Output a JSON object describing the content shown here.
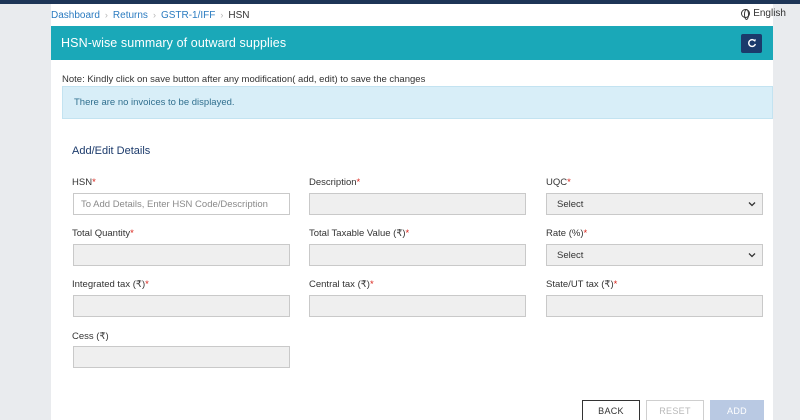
{
  "breadcrumb": {
    "items": [
      "Dashboard",
      "Returns",
      "GSTR-1/IFF"
    ],
    "current": "HSN"
  },
  "language": "English",
  "panel": {
    "title": "HSN-wise summary of outward supplies"
  },
  "note": "Note: Kindly click on save button after any modification( add, edit) to save the changes",
  "alert": "There are no invoices to be displayed.",
  "form": {
    "section_title": "Add/Edit Details",
    "fields": {
      "hsn": {
        "label": "HSN",
        "placeholder": "To Add Details, Enter HSN Code/Description",
        "required": true
      },
      "description": {
        "label": "Description",
        "required": true
      },
      "uqc": {
        "label": "UQC",
        "selected": "Select",
        "required": true
      },
      "total_quantity": {
        "label": "Total Quantity",
        "required": true
      },
      "total_taxable_value": {
        "label": "Total Taxable Value (₹)",
        "required": true
      },
      "rate": {
        "label": "Rate (%)",
        "selected": "Select",
        "required": true
      },
      "integrated_tax": {
        "label": "Integrated tax (₹)",
        "required": true
      },
      "central_tax": {
        "label": "Central tax (₹)",
        "required": true
      },
      "state_ut_tax": {
        "label": "State/UT tax (₹)",
        "required": true
      },
      "cess": {
        "label": "Cess (₹)",
        "required": false
      }
    },
    "required_marker": "*"
  },
  "buttons": {
    "back": "BACK",
    "reset": "RESET",
    "add": "ADD"
  },
  "colors": {
    "header_bg": "#1aa8b8",
    "refresh_btn": "#1b3a6b",
    "alert_bg": "#d8eef8",
    "required": "#d9241b",
    "link": "#2a7bc0"
  },
  "icons": {
    "refresh": "refresh-icon",
    "language": "globe-icon",
    "select_arrow": "chevron-down-icon"
  }
}
